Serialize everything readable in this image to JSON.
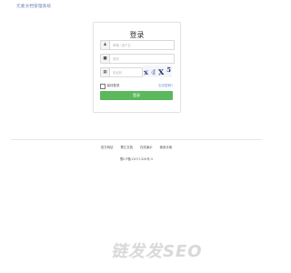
{
  "header": {
    "title": "元素文档管理系统"
  },
  "login": {
    "title": "登录",
    "username": {
      "icon": "user-icon",
      "placeholder": "邮箱 / 用户名"
    },
    "password": {
      "icon": "lock-icon",
      "placeholder": "密码"
    },
    "captcha": {
      "icon": "shield-icon",
      "placeholder": "验证码",
      "chars": [
        "x",
        "4",
        "X",
        "5"
      ]
    },
    "remember_label": "保持登录",
    "forgot_label": "忘记密码?",
    "submit_label": "登录"
  },
  "footer": {
    "links": [
      "官方网站",
      "蜀汇文档",
      "在线演示",
      "使用手册"
    ],
    "copyright": "蜀ICP备13071326号-5"
  },
  "watermark": "链发发SEO",
  "colors": {
    "accent": "#5cb85c",
    "link": "#5b8bd0",
    "header": "#6a7db8"
  }
}
